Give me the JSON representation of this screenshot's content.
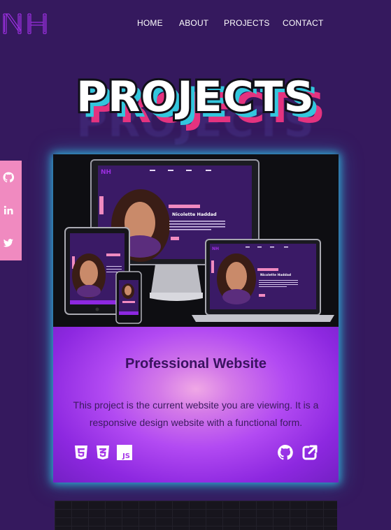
{
  "header": {
    "logo_text": "NH",
    "nav": [
      "HOME",
      "ABOUT",
      "PROJECTS",
      "CONTACT"
    ]
  },
  "section": {
    "title": "PROJECTS"
  },
  "social": [
    "github-icon",
    "linkedin-icon",
    "twitter-icon"
  ],
  "project": {
    "title": "Professional Website",
    "description": "This project is the current website you are viewing. It is a responsive design website with a functional form.",
    "tech": [
      "HTML5",
      "CSS3",
      "JS"
    ],
    "links": [
      "github-icon",
      "external-link-icon"
    ],
    "mockup": {
      "name": "Nicolette Haddad",
      "logo": "NH"
    }
  },
  "colors": {
    "background": "#35195e",
    "accent_pink": "#e4337f",
    "accent_teal": "#33c6dd",
    "social_bar": "#f08ac0"
  }
}
